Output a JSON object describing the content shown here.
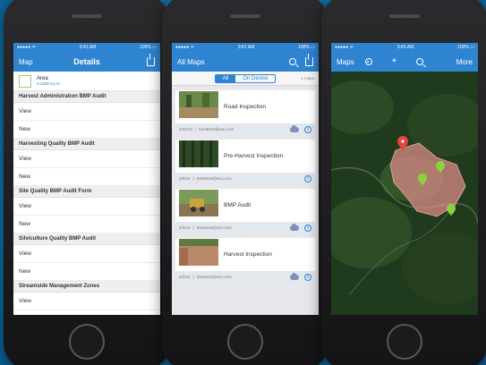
{
  "phone1": {
    "status": {
      "carrier": "●●●●● ᯤ",
      "time": "9:41 AM",
      "battery": "100% ▭"
    },
    "nav": {
      "back": "Map",
      "title": "Details"
    },
    "area": {
      "label": "Area",
      "value": "0.1608 sq mi"
    },
    "sections": [
      {
        "header": "Harvest Administration BMP Audit",
        "rows": [
          "View",
          "New"
        ]
      },
      {
        "header": "Harvesting Quality BMP Audit",
        "rows": [
          "View",
          "New"
        ]
      },
      {
        "header": "Site Quality BMP Audit Form",
        "rows": [
          "View",
          "New"
        ]
      },
      {
        "header": "Silviculture Quality BMP Audit",
        "rows": [
          "View",
          "New"
        ]
      },
      {
        "header": "Streamside Management Zones",
        "rows": [
          "View"
        ]
      }
    ]
  },
  "phone2": {
    "status": {
      "carrier": "●●●●● ᯤ",
      "time": "9:41 AM",
      "battery": "100% ▭"
    },
    "nav": {
      "title": "All Maps"
    },
    "segments": {
      "all": "All",
      "device": "On Device"
    },
    "count": "4 maps",
    "cards": [
      {
        "title": "Road Inspection",
        "date": "1/22/15",
        "user": "trav5518@esri.com"
      },
      {
        "title": "Pre-Harvest Inspection",
        "date": "2/3/15",
        "user": "trav5518@esri.com"
      },
      {
        "title": "BMP Audit",
        "date": "4/2/15",
        "user": "trav5518@esri.com"
      },
      {
        "title": "Harvest Inspection",
        "date": "4/2/15",
        "user": "trav5518@esri.com"
      }
    ],
    "info_glyph": "i"
  },
  "phone3": {
    "status": {
      "carrier": "●●●●● ᯤ",
      "time": "9:41 AM",
      "battery": "100% ▭"
    },
    "nav": {
      "back": "Maps",
      "plus": "+",
      "more": "More"
    }
  },
  "colors": {
    "accent": "#2f84d1",
    "pin_red": "#e2463c",
    "pin_green": "#8bd33b",
    "area_fill": "#d98b87"
  }
}
